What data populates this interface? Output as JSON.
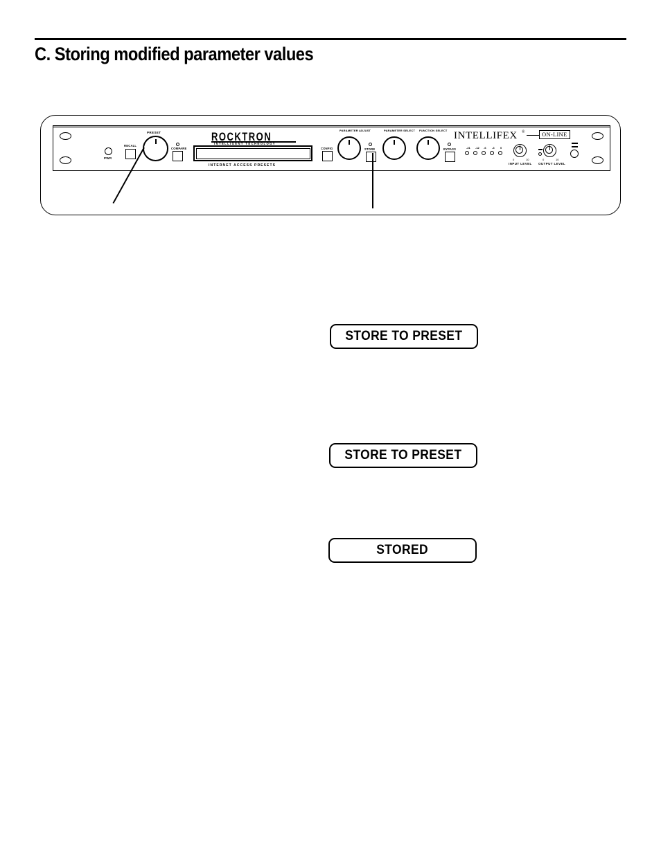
{
  "page": {
    "heading": "C. Storing modified parameter values"
  },
  "device": {
    "brand": "ROCKTRON",
    "brand_tagline": "INTELLIGENT TECHNOLOGY",
    "model_wordmark": "INTELLIFEX",
    "model_registered": "®",
    "online_badge": "ON-LINE",
    "display_caption": "INTERNET ACCESS PRESETS",
    "controls": {
      "power_label": "PWR",
      "recall_label": "RECALL",
      "compare_label": "COMPARE",
      "preset_knob_label": "PRESET",
      "config_label": "CONFIG",
      "store_label": "STORE",
      "bypass_label": "BYPASS",
      "parameter_adjust_label": "PARAMETER ADJUST",
      "parameter_select_label": "PARAMETER SELECT",
      "function_select_label": "FUNCTION SELECT",
      "input_level_label": "INPUT LEVEL",
      "output_level_label": "OUTPUT LEVEL"
    },
    "meter_scale": [
      "-21",
      "-12",
      "-6",
      "-3",
      "0"
    ],
    "input_level_ticks": [
      "0",
      "10"
    ],
    "output_level_ticks": [
      "0",
      "10"
    ]
  },
  "messages": [
    {
      "text": "STORE TO PRESET"
    },
    {
      "text": "STORE TO PRESET"
    },
    {
      "text": "STORED"
    }
  ]
}
